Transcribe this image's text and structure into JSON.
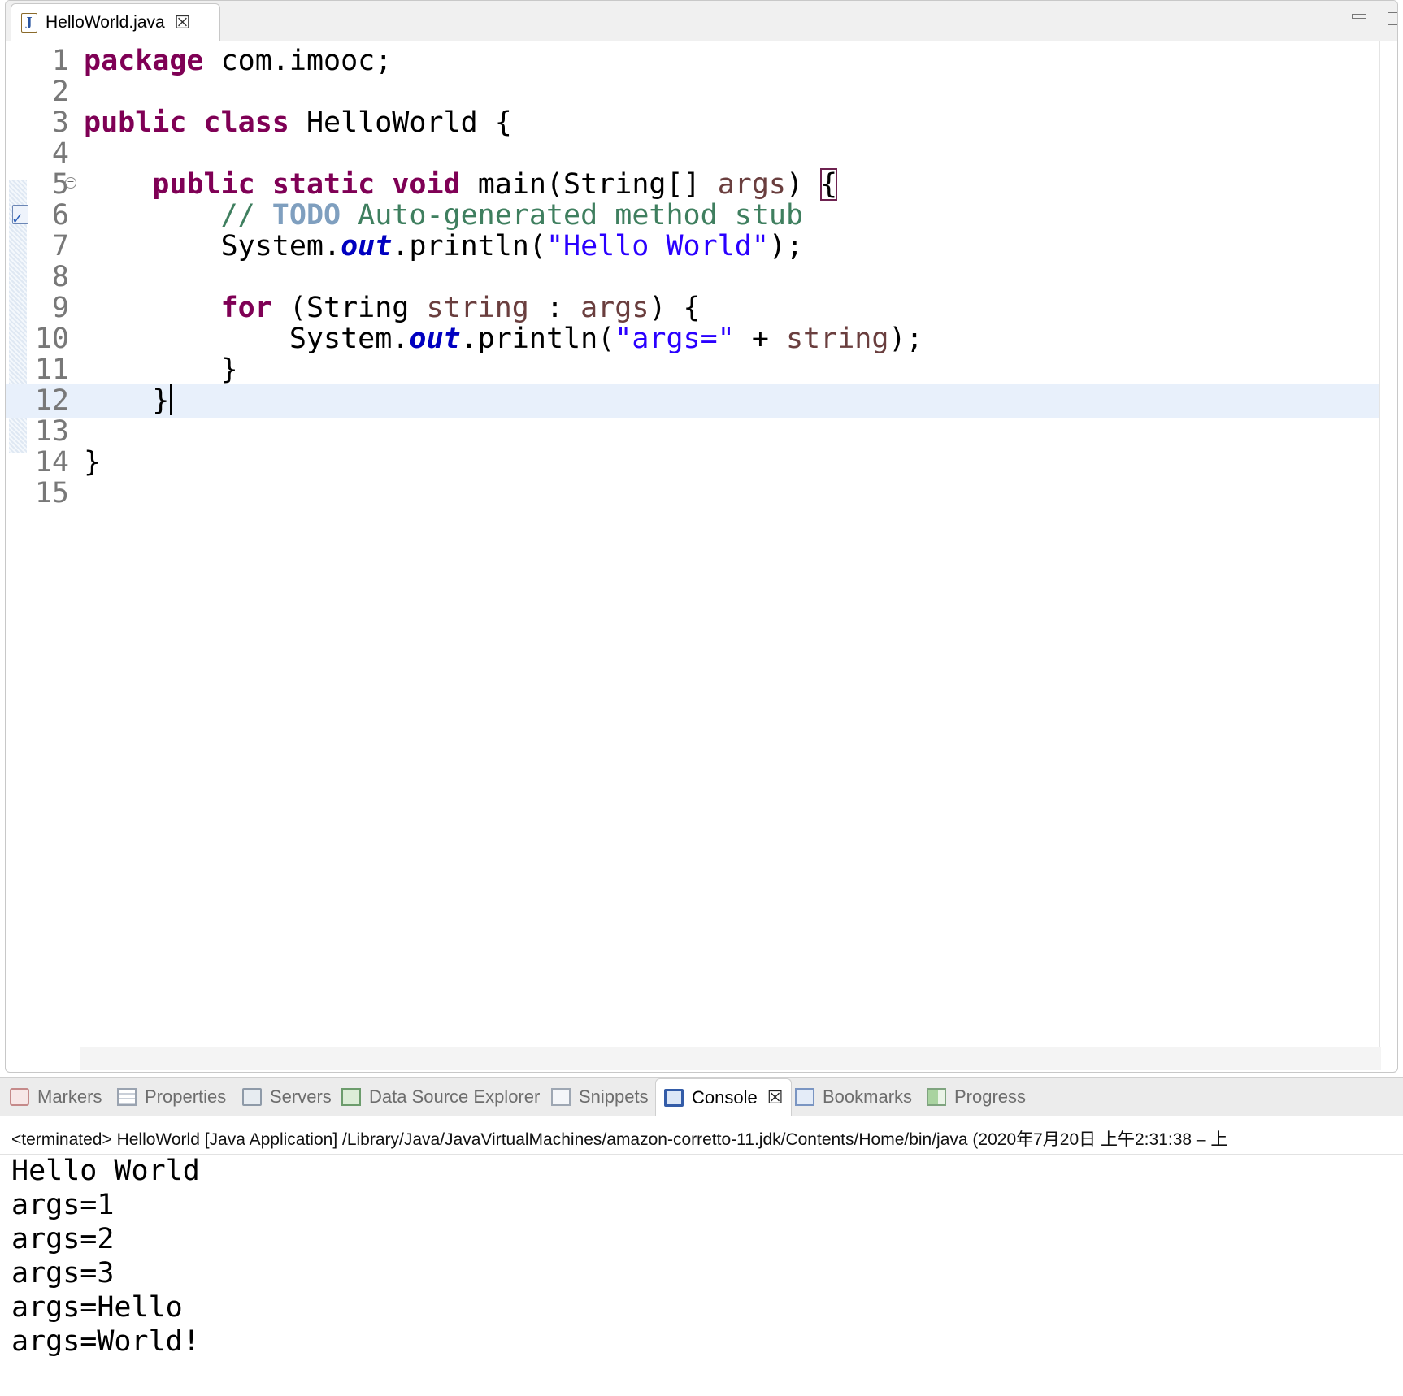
{
  "editor": {
    "tab": {
      "filename": "HelloWorld.java",
      "icon": "java-file-icon",
      "close_glyph": "☒"
    },
    "current_line": 12
  },
  "code_lines": [
    {
      "num": "1",
      "tokens": [
        {
          "t": "package",
          "c": "kw"
        },
        {
          "t": " com.imooc;",
          "c": ""
        }
      ]
    },
    {
      "num": "2",
      "tokens": []
    },
    {
      "num": "3",
      "tokens": [
        {
          "t": "public",
          "c": "kw"
        },
        {
          "t": " ",
          "c": ""
        },
        {
          "t": "class",
          "c": "kw"
        },
        {
          "t": " HelloWorld {",
          "c": ""
        }
      ]
    },
    {
      "num": "4",
      "tokens": []
    },
    {
      "num": "5",
      "tokens": [
        {
          "t": "    ",
          "c": ""
        },
        {
          "t": "public",
          "c": "kw"
        },
        {
          "t": " ",
          "c": ""
        },
        {
          "t": "static",
          "c": "kw"
        },
        {
          "t": " ",
          "c": ""
        },
        {
          "t": "void",
          "c": "kw"
        },
        {
          "t": " main(String[] ",
          "c": ""
        },
        {
          "t": "args",
          "c": "var"
        },
        {
          "t": ") ",
          "c": ""
        },
        {
          "t": "{",
          "c": "bracket-match"
        }
      ],
      "fold": true
    },
    {
      "num": "6",
      "tokens": [
        {
          "t": "        // ",
          "c": "com"
        },
        {
          "t": "TODO",
          "c": "todo"
        },
        {
          "t": " Auto-generated method stub",
          "c": "com"
        }
      ],
      "task": true
    },
    {
      "num": "7",
      "tokens": [
        {
          "t": "        System.",
          "c": ""
        },
        {
          "t": "out",
          "c": "fld"
        },
        {
          "t": ".println(",
          "c": ""
        },
        {
          "t": "\"Hello World\"",
          "c": "str"
        },
        {
          "t": ");",
          "c": ""
        }
      ]
    },
    {
      "num": "8",
      "tokens": []
    },
    {
      "num": "9",
      "tokens": [
        {
          "t": "        ",
          "c": ""
        },
        {
          "t": "for",
          "c": "kw"
        },
        {
          "t": " (String ",
          "c": ""
        },
        {
          "t": "string",
          "c": "var"
        },
        {
          "t": " : ",
          "c": ""
        },
        {
          "t": "args",
          "c": "var"
        },
        {
          "t": ") {",
          "c": ""
        }
      ]
    },
    {
      "num": "10",
      "tokens": [
        {
          "t": "            System.",
          "c": ""
        },
        {
          "t": "out",
          "c": "fld"
        },
        {
          "t": ".println(",
          "c": ""
        },
        {
          "t": "\"args=\"",
          "c": "str"
        },
        {
          "t": " + ",
          "c": ""
        },
        {
          "t": "string",
          "c": "var"
        },
        {
          "t": ");",
          "c": ""
        }
      ]
    },
    {
      "num": "11",
      "tokens": [
        {
          "t": "        }",
          "c": ""
        }
      ]
    },
    {
      "num": "12",
      "tokens": [
        {
          "t": "    }",
          "c": ""
        }
      ],
      "caret": true
    },
    {
      "num": "13",
      "tokens": []
    },
    {
      "num": "14",
      "tokens": [
        {
          "t": "}",
          "c": ""
        }
      ]
    },
    {
      "num": "15",
      "tokens": []
    }
  ],
  "views": {
    "tabs": [
      {
        "label": "Markers",
        "icon": "markers-icon",
        "active": false
      },
      {
        "label": "Properties",
        "icon": "properties-icon",
        "active": false
      },
      {
        "label": "Servers",
        "icon": "servers-icon",
        "active": false
      },
      {
        "label": "Data Source Explorer",
        "icon": "data-source-explorer-icon",
        "active": false
      },
      {
        "label": "Snippets",
        "icon": "snippets-icon",
        "active": false
      },
      {
        "label": "Console",
        "icon": "console-icon",
        "active": true,
        "close_glyph": "☒"
      },
      {
        "label": "Bookmarks",
        "icon": "bookmarks-icon",
        "active": false
      },
      {
        "label": "Progress",
        "icon": "progress-icon",
        "active": false
      }
    ]
  },
  "console": {
    "status": "<terminated> HelloWorld [Java Application] /Library/Java/JavaVirtualMachines/amazon-corretto-11.jdk/Contents/Home/bin/java  (2020年7月20日 上午2:31:38 – 上",
    "output": [
      "Hello World",
      "args=1",
      "args=2",
      "args=3",
      "args=Hello",
      "args=World!"
    ]
  }
}
